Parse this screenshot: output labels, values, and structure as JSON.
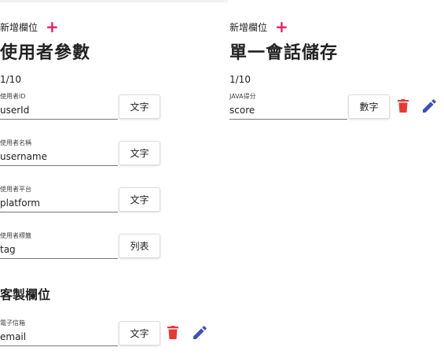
{
  "params": {
    "add_label": "新增欄位",
    "title": "使用者參數",
    "count": "1/10",
    "fields": [
      {
        "label": "使用者ID",
        "value": "userId",
        "type": "文字"
      },
      {
        "label": "使用者名稱",
        "value": "username",
        "type": "文字"
      },
      {
        "label": "使用者平台",
        "value": "platform",
        "type": "文字"
      },
      {
        "label": "使用者標籤",
        "value": "tag",
        "type": "列表"
      }
    ],
    "custom_title": "客製欄位",
    "custom_fields": [
      {
        "label": "電子信箱",
        "value": "email",
        "type": "文字"
      }
    ]
  },
  "session": {
    "add_label": "新增欄位",
    "title": "單一會話儲存",
    "count": "1/10",
    "fields": [
      {
        "label": "JAVA得分",
        "value": "score",
        "type": "數字"
      }
    ]
  },
  "colors": {
    "add": "#e91e63",
    "delete": "#e53935",
    "edit": "#3f51b5"
  },
  "icons": {
    "add": "plus-icon",
    "delete": "trash-icon",
    "edit": "pencil-icon"
  }
}
